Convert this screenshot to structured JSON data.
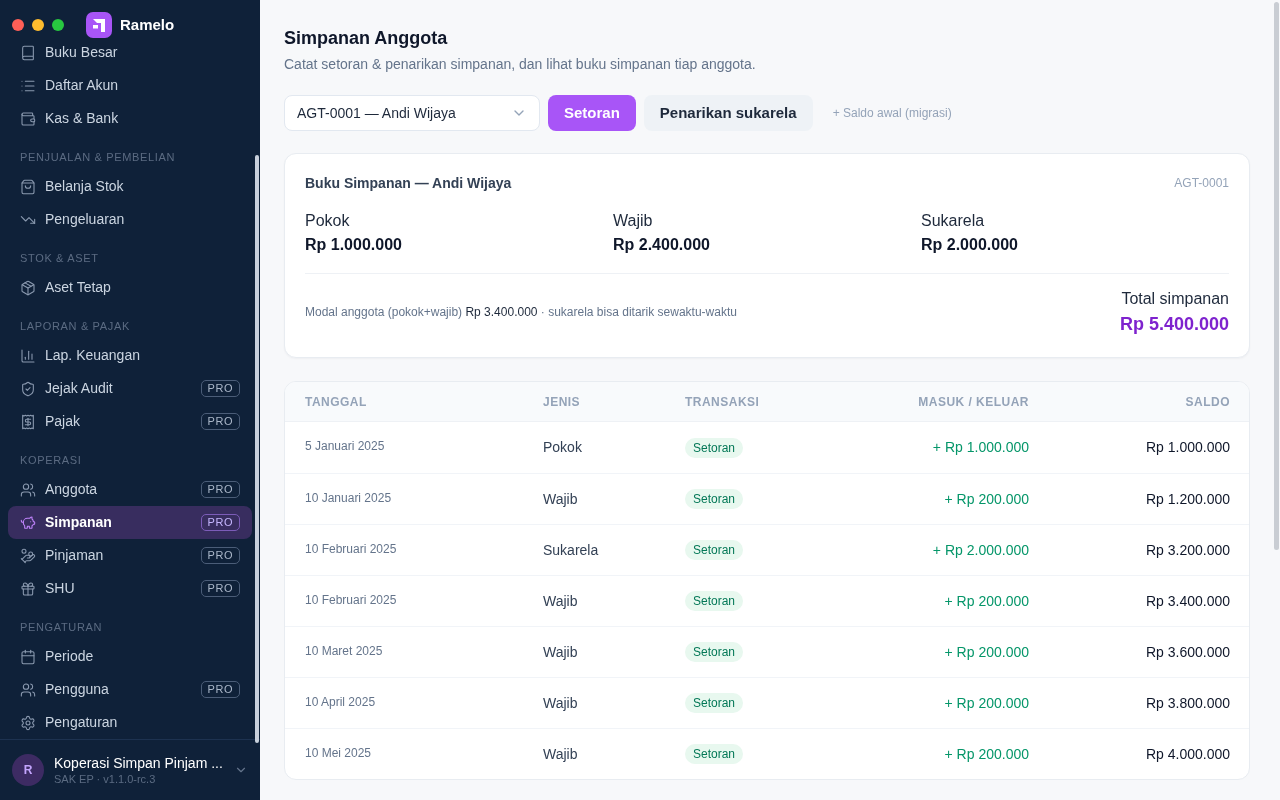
{
  "app": {
    "name": "Ramelo"
  },
  "sidebar": {
    "sections": [
      {
        "items": [
          {
            "label": "Buku Besar",
            "selected": false
          },
          {
            "label": "Daftar Akun",
            "selected": false
          },
          {
            "label": "Kas & Bank",
            "selected": false
          }
        ]
      },
      {
        "title": "PENJUALAN & PEMBELIAN",
        "items": [
          {
            "label": "Belanja Stok",
            "selected": false
          },
          {
            "label": "Pengeluaran",
            "selected": false
          }
        ]
      },
      {
        "title": "STOK & ASET",
        "items": [
          {
            "label": "Aset Tetap",
            "selected": false
          }
        ]
      },
      {
        "title": "LAPORAN & PAJAK",
        "items": [
          {
            "label": "Lap. Keuangan",
            "selected": false
          },
          {
            "label": "Jejak Audit",
            "selected": false,
            "badge": "PRO"
          },
          {
            "label": "Pajak",
            "selected": false,
            "badge": "PRO"
          }
        ]
      },
      {
        "title": "KOPERASI",
        "items": [
          {
            "label": "Anggota",
            "selected": false,
            "badge": "PRO"
          },
          {
            "label": "Simpanan",
            "selected": true,
            "badge": "PRO"
          },
          {
            "label": "Pinjaman",
            "selected": false,
            "badge": "PRO"
          },
          {
            "label": "SHU",
            "selected": false,
            "badge": "PRO"
          }
        ]
      },
      {
        "title": "PENGATURAN",
        "items": [
          {
            "label": "Periode",
            "selected": false
          },
          {
            "label": "Pengguna",
            "selected": false,
            "badge": "PRO"
          },
          {
            "label": "Pengaturan",
            "selected": false
          }
        ]
      }
    ],
    "account": {
      "initial": "R",
      "name": "Koperasi Simpan Pinjam ...",
      "subtitle": "SAK EP · v1.1.0-rc.3"
    }
  },
  "page": {
    "title": "Simpanan Anggota",
    "subtitle": "Catat setoran & penarikan simpanan, dan lihat buku simpanan tiap anggota."
  },
  "toolbar": {
    "member_select": {
      "value": "AGT-0001 — Andi Wijaya"
    },
    "buttons": [
      {
        "label": "Setoran",
        "kind": "primary"
      },
      {
        "label": "Penarikan sukarela",
        "kind": "secondary"
      },
      {
        "label": "+ Saldo awal (migrasi)",
        "kind": "link"
      }
    ]
  },
  "summary_card": {
    "title": "Buku Simpanan — Andi Wijaya",
    "member_code": "AGT-0001",
    "balances": [
      {
        "label": "Pokok",
        "value": "Rp 1.000.000"
      },
      {
        "label": "Wajib",
        "value": "Rp 2.400.000"
      },
      {
        "label": "Sukarela",
        "value": "Rp 2.000.000"
      }
    ],
    "note": "Modal anggota (pokok+wajib) **Rp 3.400.000** · sukarela bisa ditarik sewaktu-waktu",
    "total_label": "Total simpanan",
    "total_value": "Rp 5.400.000"
  },
  "table": {
    "columns": [
      "TANGGAL",
      "JENIS",
      "TRANSAKSI",
      "MASUK / KELUAR",
      "SALDO"
    ],
    "rows": [
      {
        "date": "5 Januari 2025",
        "type": "Pokok",
        "transaction": "Setoran",
        "amount": "+ Rp 1.000.000",
        "balance": "Rp 1.000.000"
      },
      {
        "date": "10 Januari 2025",
        "type": "Wajib",
        "transaction": "Setoran",
        "amount": "+ Rp 200.000",
        "balance": "Rp 1.200.000"
      },
      {
        "date": "10 Februari 2025",
        "type": "Sukarela",
        "transaction": "Setoran",
        "amount": "+ Rp 2.000.000",
        "balance": "Rp 3.200.000"
      },
      {
        "date": "10 Februari 2025",
        "type": "Wajib",
        "transaction": "Setoran",
        "amount": "+ Rp 200.000",
        "balance": "Rp 3.400.000"
      },
      {
        "date": "10 Maret 2025",
        "type": "Wajib",
        "transaction": "Setoran",
        "amount": "+ Rp 200.000",
        "balance": "Rp 3.600.000"
      },
      {
        "date": "10 April 2025",
        "type": "Wajib",
        "transaction": "Setoran",
        "amount": "+ Rp 200.000",
        "balance": "Rp 3.800.000"
      },
      {
        "date": "10 Mei 2025",
        "type": "Wajib",
        "transaction": "Setoran",
        "amount": "+ Rp 200.000",
        "balance": "Rp 4.000.000"
      }
    ]
  }
}
